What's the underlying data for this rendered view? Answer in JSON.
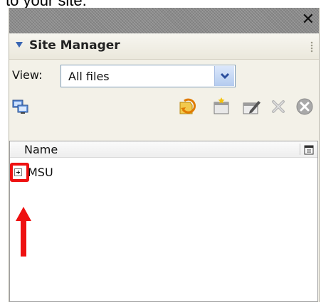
{
  "caption": {
    "text": "to your site."
  },
  "window": {
    "close_glyph": "✕"
  },
  "panel": {
    "title": "Site Manager"
  },
  "view": {
    "label": "View:",
    "selected": "All files"
  },
  "toolbar": {
    "icons": [
      "sites-icon",
      "refresh-icon",
      "new-site-icon",
      "edit-site-icon",
      "delete-icon",
      "stop-icon"
    ]
  },
  "file_list": {
    "column_name": "Name",
    "items": [
      {
        "label": "MSU",
        "expanded": false
      }
    ]
  },
  "annotation": {
    "color": "#ee1111"
  }
}
